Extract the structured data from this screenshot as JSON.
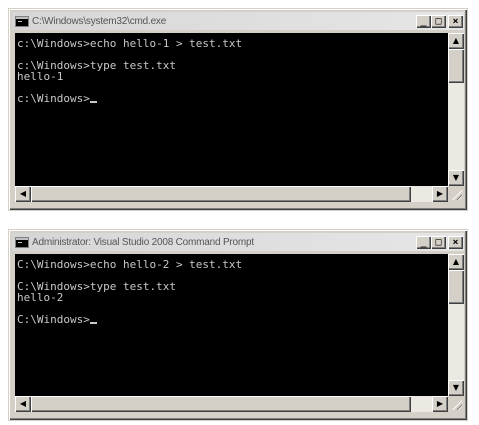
{
  "windows": [
    {
      "title": "C:\\Windows\\system32\\cmd.exe",
      "buttons": {
        "minimize": "_",
        "maximize": "□",
        "close": "×"
      },
      "lines": [
        "c:\\Windows>echo hello-1 > test.txt",
        "",
        "c:\\Windows>type test.txt",
        "hello-1",
        "",
        "c:\\Windows>"
      ]
    },
    {
      "title": "Administrator: Visual Studio 2008 Command Prompt",
      "buttons": {
        "minimize": "_",
        "maximize": "□",
        "close": "×"
      },
      "lines": [
        "C:\\Windows>echo hello-2 > test.txt",
        "",
        "C:\\Windows>type test.txt",
        "hello-2",
        "",
        "C:\\Windows>"
      ]
    }
  ],
  "scroll_glyphs": {
    "up": "▲",
    "down": "▼",
    "left": "◀",
    "right": "▶"
  },
  "icons": {
    "app": "console-icon",
    "minimize": "minimize-icon",
    "maximize": "maximize-icon",
    "close": "close-icon",
    "resize": "resize-grip-icon"
  },
  "colors": {
    "console_background": "#000000",
    "console_text": "#c8c8c8",
    "window_frame": "#d4d0c8",
    "titlebar": "#dedede"
  }
}
